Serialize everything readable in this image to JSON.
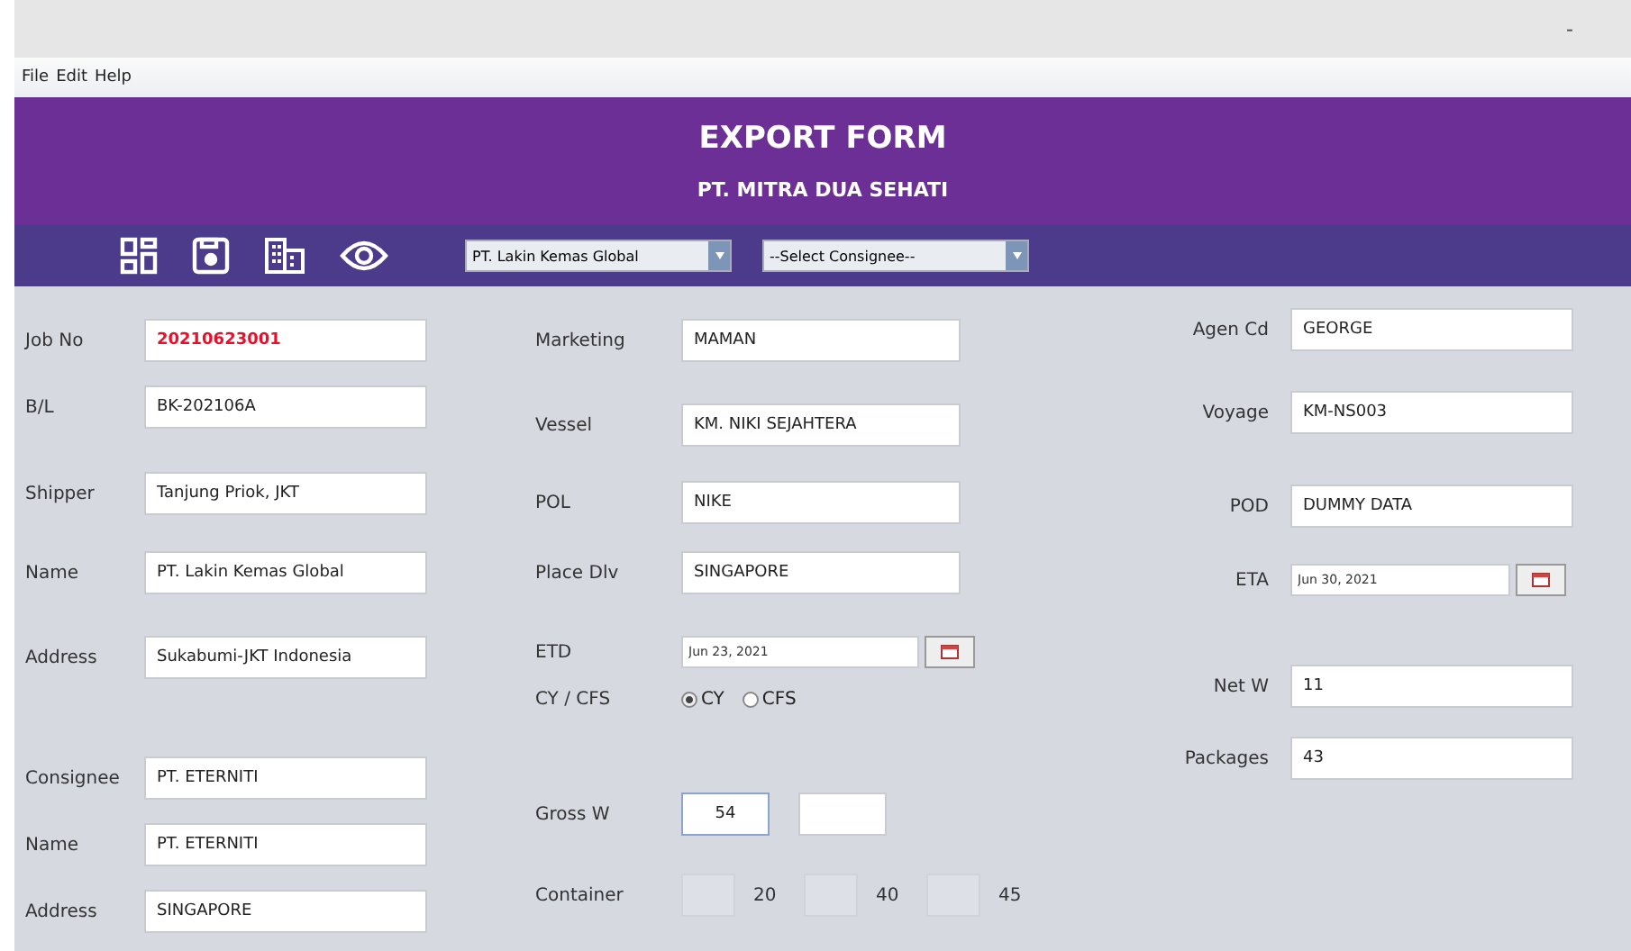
{
  "window": {
    "minimize": "-"
  },
  "menu": [
    "File",
    "Edit",
    "Help"
  ],
  "header": {
    "title": "EXPORT FORM",
    "subtitle": "PT. MITRA DUA SEHATI"
  },
  "toolbar": {
    "dropdowns": [
      "PT. Lakin Kemas Global",
      "--Select Consignee--"
    ]
  },
  "columns": [
    {
      "fields": [
        {
          "kind": "text",
          "label": "Job No",
          "value": "20210623001",
          "alert": true
        },
        {
          "kind": "text",
          "label": "B/L",
          "value": "BK-202106A",
          "alert": false
        },
        {
          "kind": "text",
          "label": "Shipper",
          "value": "Tanjung Priok, JKT",
          "alert": false
        },
        {
          "kind": "text",
          "label": "Name",
          "value": "PT. Lakin Kemas Global",
          "alert": false
        },
        {
          "kind": "text",
          "label": "Address",
          "value": "Sukabumi-JKT Indonesia",
          "alert": false
        },
        {
          "kind": "text",
          "label": "Consignee",
          "value": "PT. ETERNITI",
          "alert": false
        },
        {
          "kind": "text",
          "label": "Name",
          "value": "PT. ETERNITI",
          "alert": false
        },
        {
          "kind": "text",
          "label": "Address",
          "value": "SINGAPORE",
          "alert": false
        }
      ]
    },
    {
      "fields": [
        {
          "kind": "text",
          "label": "Marketing",
          "value": "MAMAN",
          "alert": false
        },
        {
          "kind": "text",
          "label": "Vessel",
          "value": "KM. NIKI SEJAHTERA",
          "alert": false
        },
        {
          "kind": "text",
          "label": "POL",
          "value": "NIKE",
          "alert": false
        },
        {
          "kind": "text",
          "label": "Place Dlv",
          "value": "SINGAPORE",
          "alert": false
        },
        {
          "kind": "date",
          "label": "ETD",
          "value": "Jun 23, 2021"
        },
        {
          "kind": "radio",
          "label": "CY / CFS",
          "options": [
            {
              "label": "CY",
              "selected": true
            },
            {
              "label": "CFS",
              "selected": false
            }
          ]
        },
        {
          "kind": "pair",
          "label": "Gross W",
          "value": "54"
        },
        {
          "kind": "container",
          "label": "Container",
          "sizes": [
            "20",
            "40",
            "45"
          ]
        }
      ]
    },
    {
      "fields": [
        {
          "kind": "text",
          "label": "Agen Cd",
          "value": "GEORGE",
          "alert": false
        },
        {
          "kind": "text",
          "label": "Voyage",
          "value": "KM-NS003",
          "alert": false
        },
        {
          "kind": "text",
          "label": "POD",
          "value": "DUMMY DATA",
          "alert": false
        },
        {
          "kind": "date",
          "label": "ETA",
          "value": "Jun 30, 2021"
        },
        {
          "kind": "text",
          "label": "Net W",
          "value": "11",
          "alert": false
        },
        {
          "kind": "text",
          "label": "Packages",
          "value": "43",
          "alert": false
        }
      ]
    }
  ]
}
